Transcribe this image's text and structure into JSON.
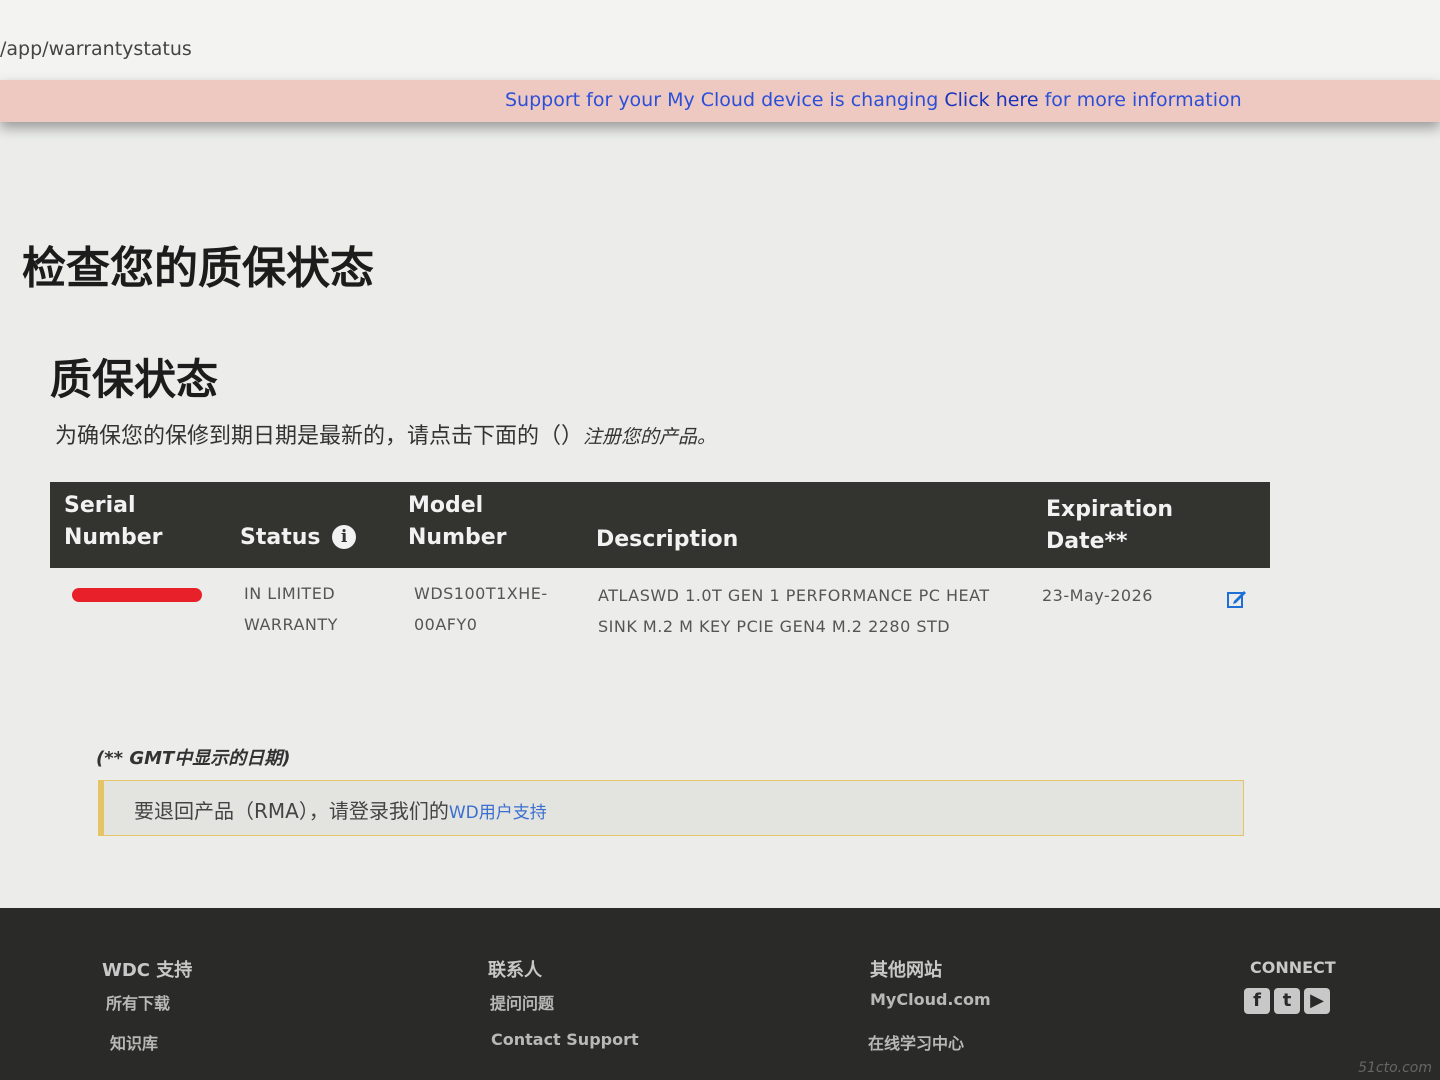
{
  "browser": {
    "url": "/app/warrantystatus"
  },
  "notice": {
    "text_before": "Support for your My Cloud device is changing ",
    "link": "Click here",
    "text_after": " for more information"
  },
  "page": {
    "title": "检查您的质保状态",
    "section_title": "质保状态",
    "intro_text": "为确保您的保修到期日期是最新的，请点击下面的（）",
    "intro_link": "注册您的产品。"
  },
  "table": {
    "headers": {
      "serial": [
        "Serial",
        "Number"
      ],
      "status": "Status",
      "model": [
        "Model",
        "Number"
      ],
      "description": "Description",
      "expiration": [
        "Expiration",
        "Date**"
      ]
    },
    "rows": [
      {
        "status": [
          "IN LIMITED",
          "WARRANTY"
        ],
        "model": [
          "WDS100T1XHE-",
          "00AFY0"
        ],
        "description": [
          "ATLASWD 1.0T GEN 1 PERFORMANCE PC HEAT",
          "SINK M.2 M KEY PCIE GEN4 M.2 2280 STD"
        ],
        "expiration": "23-May-2026"
      }
    ]
  },
  "gmt_note": "(** GMT中显示的日期)",
  "rma": {
    "text": "要退回产品（RMA），请登录我们的",
    "link": "WD用户支持"
  },
  "footer": {
    "col1": {
      "heading": "WDC 支持",
      "links": [
        "所有下载",
        "知识库"
      ]
    },
    "col2": {
      "heading": "联系人",
      "links": [
        "提问问题",
        "Contact Support"
      ]
    },
    "col3": {
      "heading": "其他网站",
      "links": [
        "MyCloud.com",
        "在线学习中心"
      ]
    },
    "connect": "CONNECT"
  },
  "icons": {
    "info": "info-icon",
    "edit": "edit-icon",
    "facebook": "facebook-icon",
    "twitter": "twitter-icon",
    "youtube": "youtube-icon"
  },
  "colors": {
    "header_bg": "#33332f",
    "notice_bg": "#eec9c2",
    "link": "#2c4fd8",
    "rma_border": "#e4c565",
    "footer_bg": "#2a2a29"
  },
  "watermark": "51cto.com"
}
